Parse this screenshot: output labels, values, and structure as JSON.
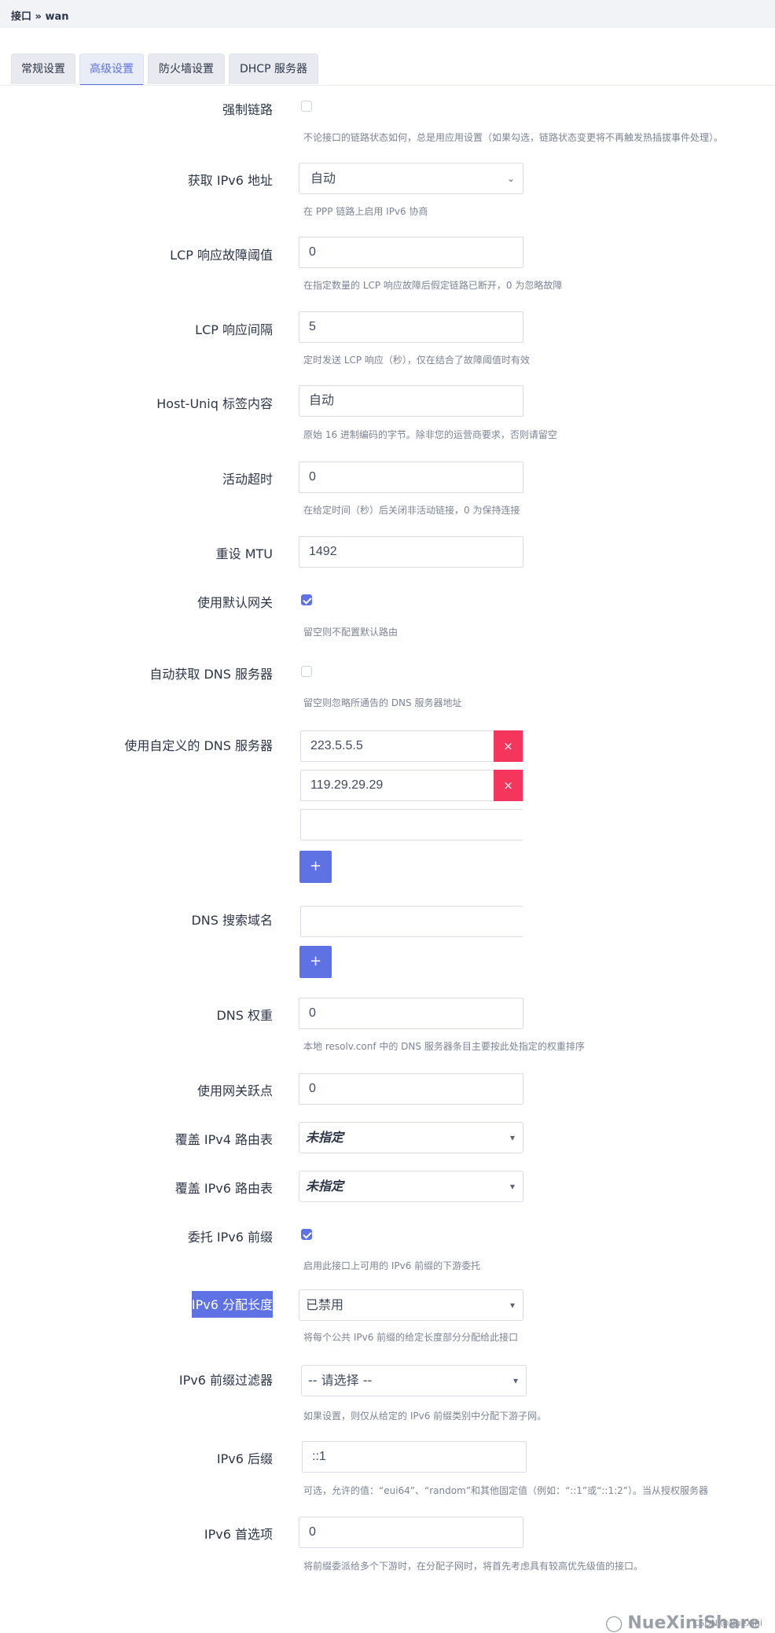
{
  "breadcrumb": "接口 » wan",
  "tabs": [
    {
      "label": "常规设置",
      "active": false
    },
    {
      "label": "高级设置",
      "active": true
    },
    {
      "label": "防火墙设置",
      "active": false
    },
    {
      "label": "DHCP 服务器",
      "active": false
    }
  ],
  "accent_color": "#5e72e4",
  "danger_color": "#f5365c",
  "fields": {
    "force_link": {
      "label": "强制链路",
      "checked": false,
      "desc": "不论接口的链路状态如何，总是用应用设置（如果勾选，链路状态变更将不再触发热插拔事件处理）。"
    },
    "ipv6": {
      "label": "获取 IPv6 地址",
      "value": "自动",
      "desc": "在 PPP 链路上启用 IPv6 协商"
    },
    "lcp_fail": {
      "label": "LCP 响应故障阈值",
      "value": "0",
      "desc": "在指定数量的 LCP 响应故障后假定链路已断开，0 为忽略故障"
    },
    "lcp_interval": {
      "label": "LCP 响应间隔",
      "value": "5",
      "desc": "定时发送 LCP 响应（秒），仅在结合了故障阈值时有效"
    },
    "host_uniq": {
      "label": "Host-Uniq 标签内容",
      "value": "自动",
      "desc": "原始 16 进制编码的字节。除非您的运营商要求，否则请留空"
    },
    "idle": {
      "label": "活动超时",
      "value": "0",
      "desc": "在给定时间（秒）后关闭非活动链接，0 为保持连接"
    },
    "mtu": {
      "label": "重设 MTU",
      "value": "1492"
    },
    "default_gw": {
      "label": "使用默认网关",
      "checked": true,
      "desc": "留空则不配置默认路由"
    },
    "peer_dns": {
      "label": "自动获取 DNS 服务器",
      "checked": false,
      "desc": "留空则忽略所通告的 DNS 服务器地址"
    },
    "custom_dns": {
      "label": "使用自定义的 DNS 服务器",
      "items": [
        "223.5.5.5",
        "119.29.29.29"
      ],
      "remove_label": "×",
      "add_label": "+"
    },
    "dns_search": {
      "label": "DNS 搜索域名",
      "add_label": "+"
    },
    "dns_weight": {
      "label": "DNS 权重",
      "value": "0",
      "desc": "本地 resolv.conf 中的 DNS 服务器条目主要按此处指定的权重排序"
    },
    "metric": {
      "label": "使用网关跃点",
      "value": "0"
    },
    "ip4table": {
      "label": "覆盖 IPv4 路由表",
      "value": "未指定"
    },
    "ip6table": {
      "label": "覆盖 IPv6 路由表",
      "value": "未指定"
    },
    "delegate": {
      "label": "委托 IPv6 前缀",
      "checked": true,
      "desc": "启用此接口上可用的 IPv6 前缀的下游委托"
    },
    "ip6assign": {
      "label": "IPv6 分配长度",
      "value": "已禁用",
      "desc": "将每个公共 IPv6 前缀的给定长度部分分配给此接口"
    },
    "ip6class": {
      "label": "IPv6 前缀过滤器",
      "value": "-- 请选择 --",
      "desc": "如果设置，则仅从给定的 IPv6 前缀类别中分配下游子网。"
    },
    "ip6hint_suffix": {
      "label": "IPv6 后缀",
      "value": "::1",
      "desc": "可选，允许的值：“eui64”、“random”和其他固定值（例如：“::1”或“::1:2”）。当从授权服务器"
    },
    "ip6weight": {
      "label": "IPv6 首选项",
      "value": "0",
      "desc": "将前缀委派给多个下游时，在分配子网时，将首先考虑具有较高优先级值的接口。"
    }
  },
  "watermark": {
    "brand": "NueXiniShare",
    "icon": "wechat-icon",
    "csdn": "CSDN @NueXini"
  }
}
